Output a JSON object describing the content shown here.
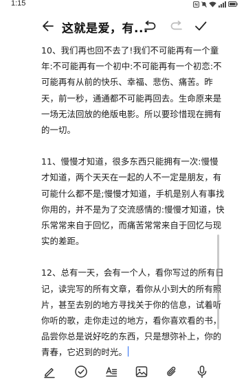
{
  "status_bar": {
    "time": "1:15",
    "icons": [
      "nfc-icon",
      "silent-icon",
      "wifi-icon",
      "signal-icon",
      "battery-icon"
    ]
  },
  "title_bar": {
    "title": "这就是爱，有...",
    "icons": [
      "back-arrow-icon",
      "undo-icon",
      "redo-icon",
      "checkmark-icon"
    ]
  },
  "content": {
    "paragraphs": [
      "10、我们再也回不去了!我们不可能再有一个童年:不可能再有一个初中:不可能再有一个初恋:不可能再有从前的快乐、幸福、悲伤、痛苦。昨天，前一秒，通通都不可能再回去。生命原来是一场无法回放的绝版电影。所以要珍惜现在拥有的一切。",
      "11、慢慢才知道，很多东西只能拥有一次:慢慢才知道，两个天天在一起的人不一定是朋友，有可能什么都不是;慢慢才知道，手机是别人有事找你用的，并不是为了交流感情的:慢慢才知道，快乐常常来自于回忆，而痛苦常常来自于回忆与现实的差距。",
      "12、总有一天，会有一个人，看你写过的所有日记，读完写的所有文章，看你从小到大的所有照片，甚至去别的地方寻找关于你的信息，试着听你听的歌，走你走过的地方，看你喜欢看的书，品尝你总是说好吃的东西，只是想弥补上，你的青春，它迟到的时光。"
    ]
  },
  "editor_toolbar": {
    "tools": [
      "handwriting-pen-icon",
      "checklist-icon",
      "text-format-icon",
      "insert-image-icon",
      "attachment-icon",
      "voice-input-icon"
    ]
  },
  "colors": {
    "accent": "#2a6df4",
    "text": "#1a1a1a",
    "background": "#ffffff"
  }
}
